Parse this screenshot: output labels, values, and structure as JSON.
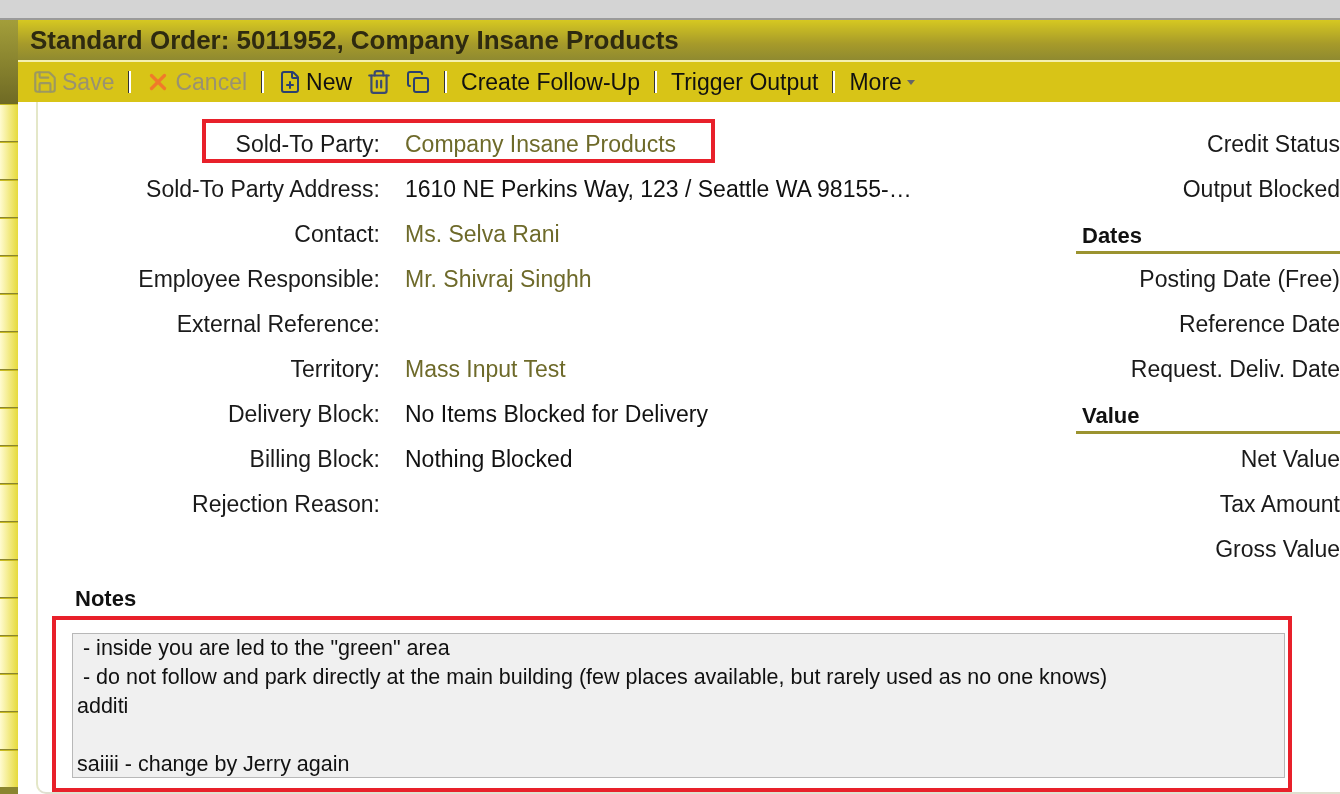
{
  "window": {
    "title": "Standard Order: 5011952, Company Insane Products"
  },
  "toolbar": [
    {
      "kind": "save",
      "label": "Save",
      "disabled": true
    },
    {
      "kind": "cancel",
      "label": "Cancel",
      "disabled": true
    },
    {
      "kind": "new",
      "label": "New",
      "disabled": false
    },
    {
      "kind": "delete",
      "disabled": false
    },
    {
      "kind": "copy",
      "disabled": false
    },
    {
      "kind": "text",
      "label": "Create Follow-Up",
      "disabled": false
    },
    {
      "kind": "text",
      "label": "Trigger Output",
      "disabled": false
    },
    {
      "kind": "menu",
      "label": "More",
      "disabled": false
    }
  ],
  "fields": [
    {
      "label": "Sold-To Party:",
      "value": "Company Insane Products",
      "kind": "link",
      "highlighted": true
    },
    {
      "label": "Sold-To Party Address:",
      "value": "1610 NE Perkins Way, 123 / Seattle WA 98155-…",
      "kind": "text",
      "highlighted": false
    },
    {
      "label": "Contact:",
      "value": "Ms. Selva Rani",
      "kind": "link",
      "highlighted": false
    },
    {
      "label": "Employee Responsible:",
      "value": "Mr. Shivraj Singhh",
      "kind": "link",
      "highlighted": false
    },
    {
      "label": "External Reference:",
      "kind": "text",
      "highlighted": false
    },
    {
      "label": "Territory:",
      "value": "Mass Input Test",
      "kind": "link",
      "highlighted": false
    },
    {
      "label": "Delivery Block:",
      "value": "No Items Blocked for Delivery",
      "kind": "text",
      "highlighted": false
    },
    {
      "label": "Billing Block:",
      "value": "Nothing Blocked",
      "kind": "text",
      "highlighted": false
    },
    {
      "label": "Rejection Reason:",
      "kind": "text",
      "highlighted": false
    }
  ],
  "side_panel": [
    {
      "kind": "field",
      "label": "Credit Status"
    },
    {
      "kind": "field",
      "label": "Output Blocked"
    },
    {
      "kind": "heading",
      "label": "Dates"
    },
    {
      "kind": "field",
      "label": "Posting Date (Free)"
    },
    {
      "kind": "field",
      "label": "Reference Date"
    },
    {
      "kind": "field",
      "label": "Request. Deliv. Date"
    },
    {
      "kind": "heading",
      "label": "Value"
    },
    {
      "kind": "field",
      "label": "Net Value"
    },
    {
      "kind": "field",
      "label": "Tax Amount"
    },
    {
      "kind": "field",
      "label": "Gross Value"
    }
  ],
  "notes": {
    "title": "Notes",
    "value": " - inside you are led to the \"green\" area\n - do not follow and park directly at the main building (few places available, but rarely used as no one knows)\nadditi\n\nsaiiii - change by Jerry again",
    "highlighted": true
  }
}
